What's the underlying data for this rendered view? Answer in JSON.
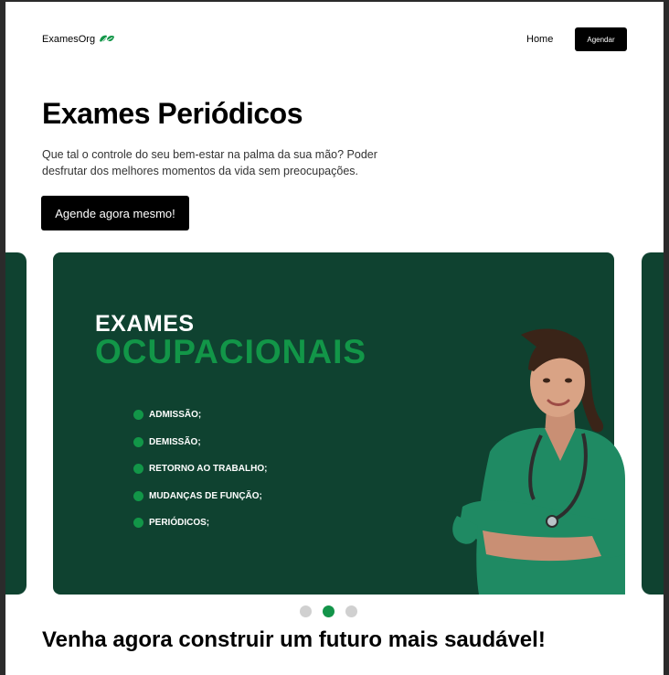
{
  "header": {
    "brand": "ExamesOrg",
    "nav_home": "Home",
    "cta": "Agendar"
  },
  "hero": {
    "title": "Exames Periódicos",
    "description": "Que tal o controle do seu bem-estar na palma da sua mão? Poder desfrutar dos melhores momentos da vida sem preocupações.",
    "cta": "Agende agora mesmo!"
  },
  "carousel": {
    "slide": {
      "kicker": "EXAMES",
      "heading": "OCUPACIONAIS",
      "bullets": [
        "ADMISSÃO;",
        "DEMISSÃO;",
        "RETORNO AO TRABALHO;",
        "MUDANÇAS DE FUNÇÃO;",
        "PERIÓDICOS;"
      ]
    },
    "active_dot": 2,
    "dot_count": 3
  },
  "section": {
    "heading": "Venha agora construir um futuro mais saudável!"
  },
  "colors": {
    "brand_green": "#129648",
    "slide_bg": "#0f4230",
    "button_bg": "#000000"
  },
  "icons": {
    "brand_logo": "leaf-icon",
    "slide_image": "nurse-photo"
  }
}
